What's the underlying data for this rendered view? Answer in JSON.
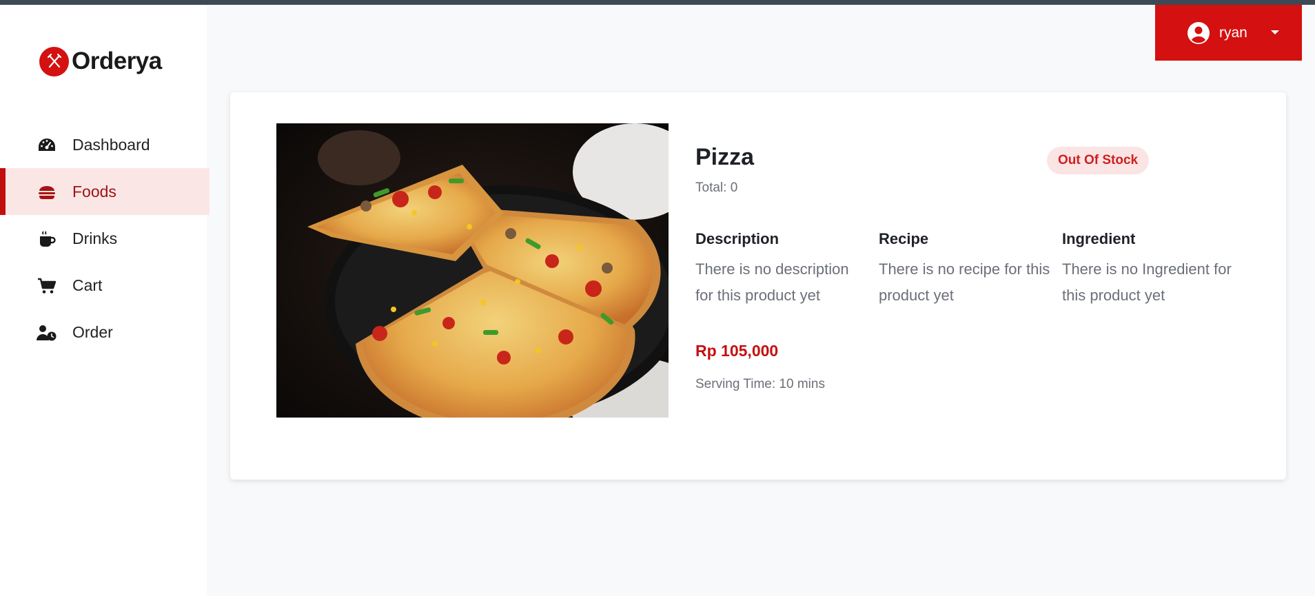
{
  "app": {
    "name": "Orderya",
    "brand_color": "#d41010"
  },
  "sidebar": {
    "items": [
      {
        "label": "Dashboard",
        "icon": "tachometer-icon",
        "active": false
      },
      {
        "label": "Foods",
        "icon": "burger-icon",
        "active": true
      },
      {
        "label": "Drinks",
        "icon": "mug-icon",
        "active": false
      },
      {
        "label": "Cart",
        "icon": "cart-icon",
        "active": false
      },
      {
        "label": "Order",
        "icon": "user-clock-icon",
        "active": false
      }
    ]
  },
  "header": {
    "user": {
      "name": "ryan",
      "icon": "user-circle-icon"
    }
  },
  "product": {
    "name": "Pizza",
    "total": "Total: 0",
    "status": "Out Of Stock",
    "description": {
      "heading": "Description",
      "text": "There is no description for this product yet"
    },
    "recipe": {
      "heading": "Recipe",
      "text": "There is no recipe for this product yet"
    },
    "ingredient": {
      "heading": "Ingredient",
      "text": "There is no Ingredient for this product yet"
    },
    "price": "Rp 105,000",
    "serving_time": "Serving Time: 10 mins",
    "image": "pizza-photo"
  }
}
